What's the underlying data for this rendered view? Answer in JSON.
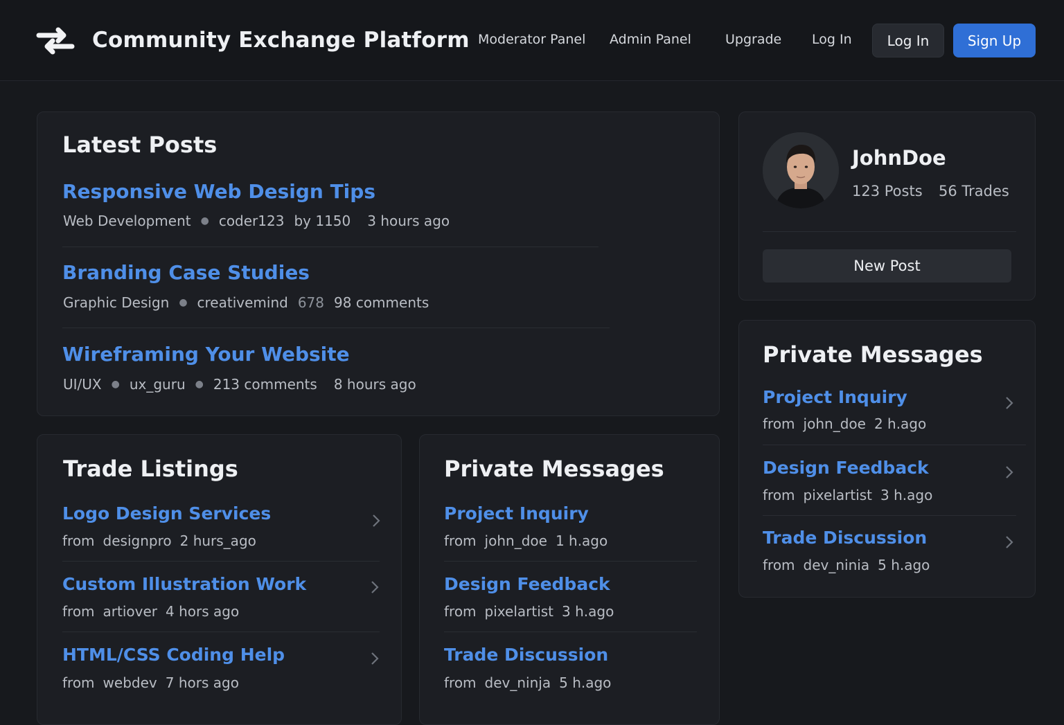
{
  "header": {
    "title": "Community Exchange Platform",
    "nav": [
      "Moderator Panel",
      "Admin Panel",
      "Upgrade",
      "Log In"
    ],
    "login_button": "Log In",
    "signup_button": "Sign Up",
    "logo_icon": "exchange-arrows-icon"
  },
  "latest_posts": {
    "title": "Latest Posts",
    "posts": [
      {
        "title": "Responsive Web Design Tips",
        "meta": [
          "Web Development",
          "coder123",
          "by 1150",
          "3 hours ago"
        ]
      },
      {
        "title": "Branding Case Studies",
        "meta": [
          "Graphic Design",
          "creativemind",
          "678",
          "98 comments"
        ]
      },
      {
        "title": "Wireframing Your Website",
        "meta": [
          "UI/UX",
          "ux_guru",
          "213 comments",
          "8 hours ago"
        ]
      }
    ]
  },
  "trade_listings": {
    "title": "Trade Listings",
    "items": [
      {
        "title": "Logo Design Services",
        "from": "from",
        "user": "designpro",
        "time": "2 hurs_ago"
      },
      {
        "title": "Custom Illustration Work",
        "from": "from",
        "user": "artiover",
        "time": "4 hors ago"
      },
      {
        "title": "HTML/CSS Coding Help",
        "from": "from",
        "user": "webdev",
        "time": "7 hors ago"
      }
    ]
  },
  "private_messages_main": {
    "title": "Private Messages",
    "items": [
      {
        "title": "Project Inquiry",
        "from": "from",
        "user": "john_doe",
        "time": "1 h.ago"
      },
      {
        "title": "Design Feedback",
        "from": "from",
        "user": "pixelartist",
        "time": "3 h.ago"
      },
      {
        "title": "Trade Discussion",
        "from": "from",
        "user": "dev_ninja",
        "time": "5 h.ago"
      }
    ]
  },
  "profile": {
    "username": "JohnDoe",
    "posts": "123 Posts",
    "trades": "56 Trades",
    "new_post_button": "New Post"
  },
  "private_messages_side": {
    "title": "Private Messages",
    "items": [
      {
        "title": "Project Inquiry",
        "from": "from",
        "user": "john_doe",
        "time": "2 h.ago"
      },
      {
        "title": "Design Feedback",
        "from": "from",
        "user": "pixelartist",
        "time": "3 h.ago"
      },
      {
        "title": "Trade Discussion",
        "from": "from",
        "user": "dev_ninia",
        "time": "5 h.ago"
      }
    ]
  },
  "colors": {
    "accent": "#4f8fe8",
    "primary_button": "#2f6fd6",
    "background": "#17191d",
    "card": "#1c1e23"
  }
}
